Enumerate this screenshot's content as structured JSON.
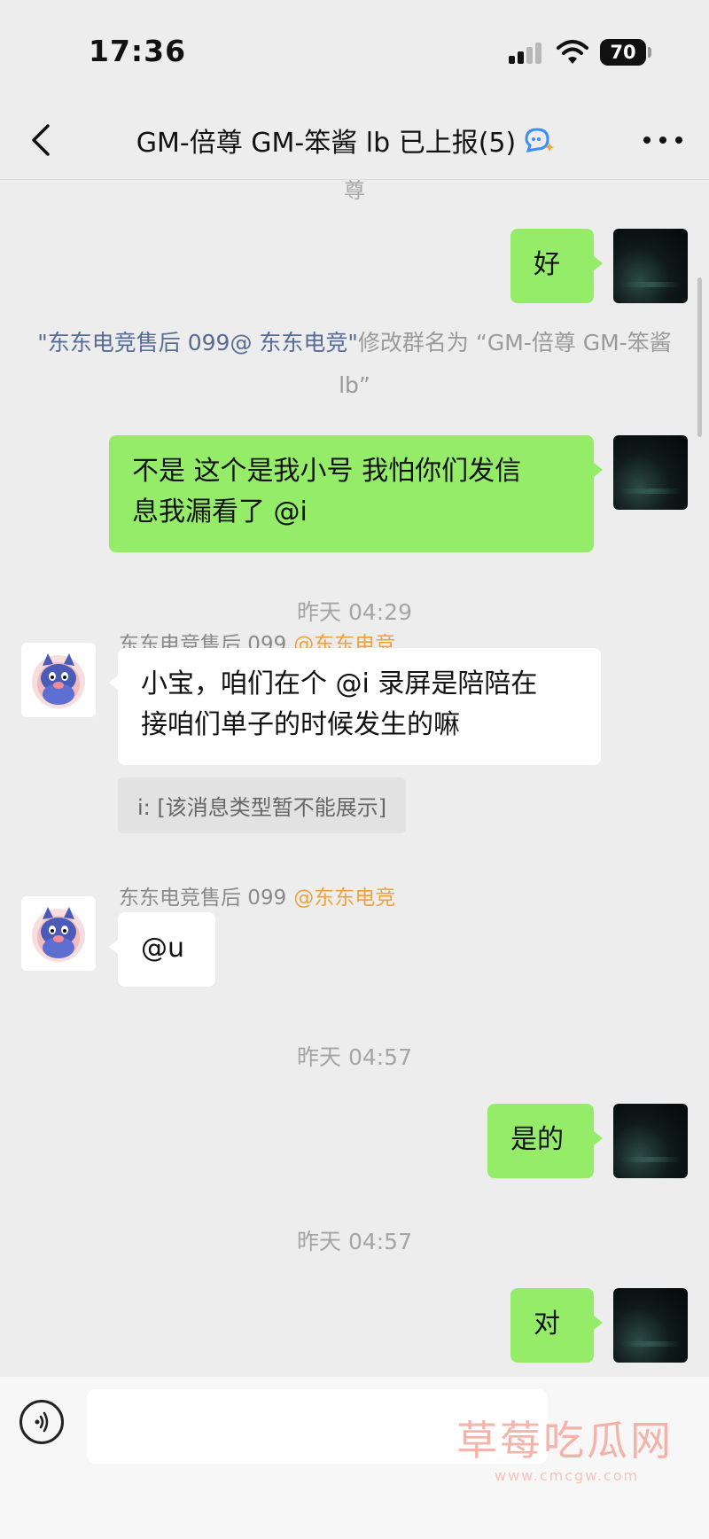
{
  "status_bar": {
    "time": "17:36",
    "battery": "70"
  },
  "header": {
    "title": "GM-倍尊 GM-笨酱 lb 已上报(5)"
  },
  "chat": {
    "cut_text": "尊",
    "messages": [
      {
        "text": "好"
      },
      {
        "system_name": "\"东东电竞售后 099@ 东东电竞\"",
        "system_rest": "修改群名为 “GM-倍尊 GM-笨酱 lb”"
      },
      {
        "text_line1": "不是 这个是我小号 我怕你们发信",
        "text_line2": "息我漏看了 @i"
      },
      {
        "time": "昨天 04:29"
      },
      {
        "sender": "东东电竞售后 099",
        "sender_tag": "@东东电竞",
        "text_line1": "小宝，咱们在个 @i 录屏是陪陪在",
        "text_line2": "接咱们单子的时候发生的嘛",
        "quote": "i: [该消息类型暂不能展示]"
      },
      {
        "sender": "东东电竞售后 099",
        "sender_tag": "@东东电竞",
        "text": "@u"
      },
      {
        "time": "昨天 04:57"
      },
      {
        "text": "是的"
      },
      {
        "time": "昨天 04:57"
      },
      {
        "text": "对"
      }
    ]
  },
  "input": {
    "placeholder": ""
  },
  "watermark": {
    "text": "草莓吃瓜网",
    "url": "www.cmcgw.com"
  }
}
